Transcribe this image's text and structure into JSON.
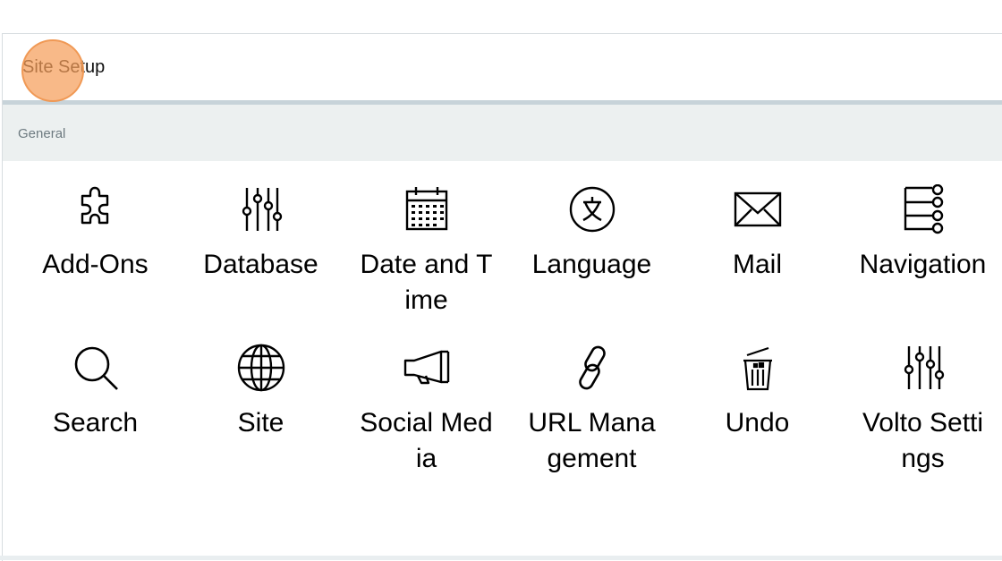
{
  "header": {
    "title": "Site Setup"
  },
  "section": {
    "label": "General"
  },
  "tiles": [
    {
      "label": "Add-Ons",
      "icon": "puzzle-icon"
    },
    {
      "label": "Database",
      "icon": "sliders-icon"
    },
    {
      "label": "Date and Time",
      "icon": "calendar-icon"
    },
    {
      "label": "Language",
      "icon": "language-icon"
    },
    {
      "label": "Mail",
      "icon": "mail-icon"
    },
    {
      "label": "Navigation",
      "icon": "navigation-tree-icon"
    },
    {
      "label": "Search",
      "icon": "search-icon"
    },
    {
      "label": "Site",
      "icon": "globe-icon"
    },
    {
      "label": "Social Media",
      "icon": "megaphone-icon"
    },
    {
      "label": "URL Management",
      "icon": "link-icon"
    },
    {
      "label": "Undo",
      "icon": "trash-undo-icon"
    },
    {
      "label": "Volto Settings",
      "icon": "sliders-icon"
    }
  ],
  "colors": {
    "section_bg": "#ecf0f0",
    "header_border": "#c7d3d9",
    "click_marker": "#f59e5a"
  }
}
